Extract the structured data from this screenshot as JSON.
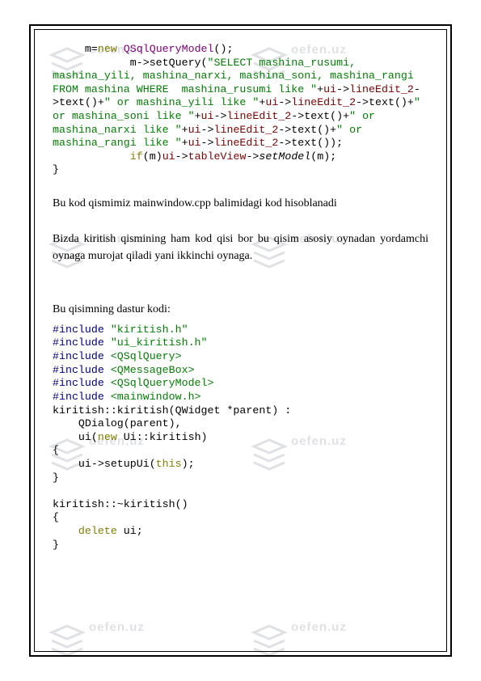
{
  "watermark": {
    "brand": "oefen",
    "suffix": ".uz"
  },
  "code1": {
    "l1a": "     m=",
    "l1b": "new",
    "l1c": " QSqlQueryModel",
    "l1d": "();",
    "l2a": "            m->setQuery(",
    "l2b": "\"SELECT mashina_rusumi, mashina_yili, mashina_narxi, mashina_soni, mashina_rangi FROM mashina WHERE  mashina_rusumi like \"",
    "l2c": "+",
    "l2d": "ui",
    "l2e": "->",
    "l2f": "lineEdit_2",
    "l2g": "->text()+",
    "s1": "\" or mashina_yili like \"",
    "s2": "\" or mashina_soni like \"",
    "s3": "\" or mashina_narxi like \"",
    "s4": "\" or mashina_rangi like \"",
    "tail": "->text());",
    "l7a": "            ",
    "l7b": "if",
    "l7c": "(m)",
    "l7d": "ui",
    "l7e": "->",
    "l7f": "tableView",
    "l7g": "->",
    "l7h": "setModel",
    "l7i": "(m);",
    "l8": "}"
  },
  "prose": {
    "p1": "Bu kod qismimiz mainwindow.cpp balimidagi kod hisoblanadi",
    "p2": "Bizda kiritish qismining ham kod qisi bor bu qisim asosiy oynadan yordamchi oynaga murojat qiladi yani ikkinchi oynaga.",
    "p3": "Bu qisimning dastur kodi:"
  },
  "code2": {
    "inc": "#include",
    "h1": "\"kiritish.h\"",
    "h2": "\"ui_kiritish.h\"",
    "h3": "<QSqlQuery>",
    "h4": "<QMessageBox>",
    "h5": "<QSqlQueryModel>",
    "h6": "<mainwindow.h>",
    "ctor1": "kiritish::kiritish(QWidget *parent) :",
    "ctor2": "    QDialog(parent),",
    "ctor3a": "    ui(",
    "ctor3b": "new",
    "ctor3c": " Ui::kiritish)",
    "ob": "{",
    "s1a": "    ui->setupUi(",
    "s1b": "this",
    "s1c": ");",
    "cb": "}",
    "dtor": "kiritish::~kiritish()",
    "ob2": "{",
    "d1a": "    ",
    "d1b": "delete",
    "d1c": " ui;",
    "cb2": "}"
  }
}
